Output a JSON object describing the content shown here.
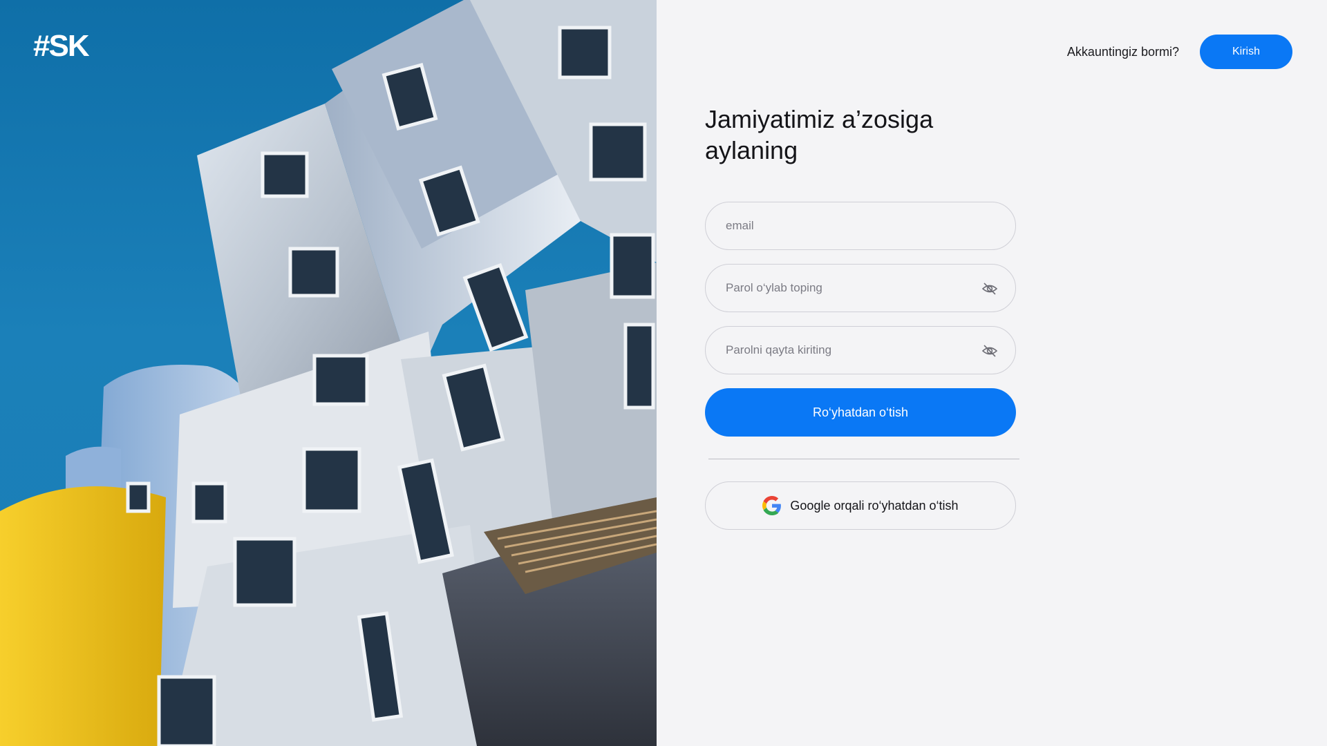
{
  "brand": {
    "logo_text": "#SK"
  },
  "header": {
    "question": "Akkauntingiz bormi?",
    "login_label": "Kirish"
  },
  "form": {
    "title": "Jamiyatimiz a’zosiga aylaning",
    "email_placeholder": "email",
    "password_placeholder": "Parol o‘ylab toping",
    "password_repeat_placeholder": "Parolni qayta kiriting",
    "submit_label": "Ro‘yhatdan o‘tish",
    "google_label": "Google orqali ro‘yhatdan o‘tish"
  },
  "icons": {
    "eye_off": "eye-off-icon",
    "google": "google-icon"
  },
  "colors": {
    "accent": "#0a78f5",
    "background": "#f4f4f6",
    "text": "#141418",
    "sky": "#1a7db5",
    "yellow_accent": "#f2c21b"
  }
}
